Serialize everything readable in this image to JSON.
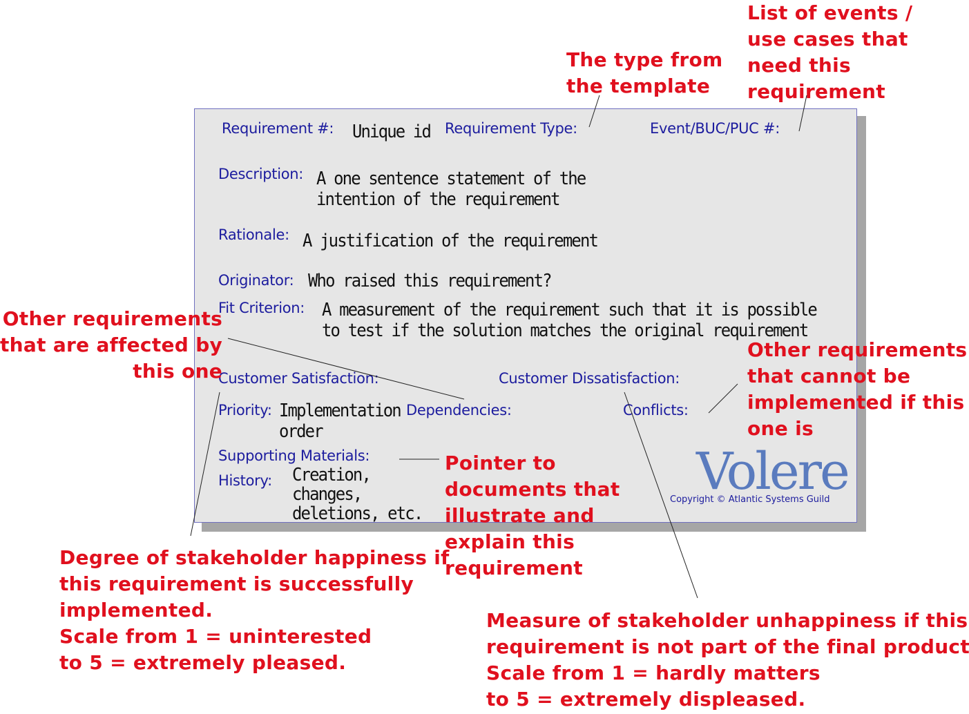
{
  "card": {
    "fields": {
      "requirement_num": "Requirement  #:",
      "requirement_type": "Requirement Type:",
      "event_buc_puc": "Event/BUC/PUC #:",
      "description": "Description:",
      "rationale": "Rationale:",
      "originator": "Originator:",
      "fit_criterion": "Fit Criterion:",
      "customer_satisfaction": "Customer Satisfaction:",
      "customer_dissatisfaction": "Customer Dissatisfaction:",
      "priority": "Priority:",
      "dependencies": "Dependencies:",
      "conflicts": "Conflicts:",
      "supporting_materials": "Supporting Materials:",
      "history": "History:"
    },
    "values": {
      "requirement_num": "Unique id",
      "description": "A one sentence statement of the\nintention of the requirement",
      "rationale": "A justification of the requirement",
      "originator": "Who raised this requirement?",
      "fit_criterion": "A measurement of the requirement such that it is possible\nto test if the solution matches the original requirement",
      "priority": "Implementation\norder",
      "history": "Creation,\nchanges,\ndeletions, etc."
    },
    "logo": "Volere",
    "copyright": "Copyright © Atlantic Systems Guild"
  },
  "annotations": {
    "type_from_template": "The type from\nthe template",
    "list_of_events": "List of events /\nuse cases that\nneed this\nrequirement",
    "other_affected": "Other requirements\nthat are affected by\n           this one",
    "other_conflicting": "Other requirements\nthat cannot be\nimplemented if this\none is",
    "pointer_documents": "Pointer to\ndocuments that\nillustrate and\nexplain this\nrequirement",
    "satisfaction_scale": "Degree of stakeholder happiness if\nthis requirement is successfully\nimplemented.\nScale from 1 = uninterested\nto 5 = extremely pleased.",
    "dissatisfaction_scale": "Measure of stakeholder unhappiness if this\nrequirement is not part of the final product.\nScale from 1 = hardly matters\nto 5 = extremely displeased."
  },
  "colors": {
    "label": "#1c1c9e",
    "annotation": "#e0101e",
    "card_bg": "#e6e6e6",
    "logo": "#5a7bbe"
  }
}
